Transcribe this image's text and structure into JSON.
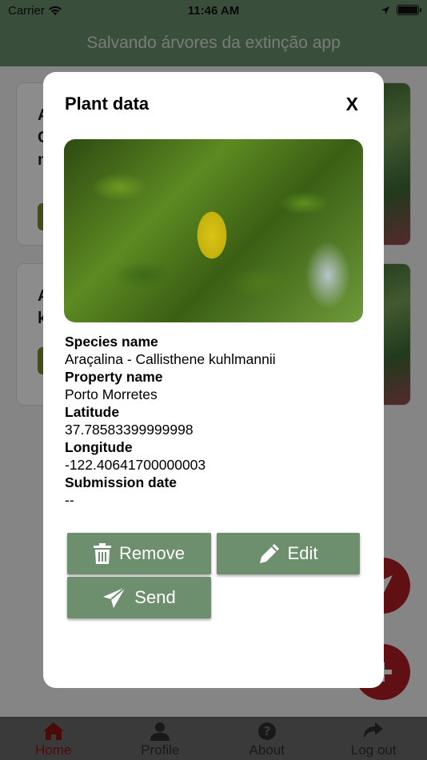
{
  "status_bar": {
    "carrier": "Carrier",
    "time": "11:46 AM"
  },
  "header": {
    "title": "Salvando árvores da extinção app"
  },
  "background_cards": [
    {
      "title_lines": [
        "A",
        "C",
        "n"
      ]
    },
    {
      "title_lines": [
        "A",
        "k"
      ]
    }
  ],
  "modal": {
    "title": "Plant data",
    "close_label": "X",
    "fields": [
      {
        "label": "Species name",
        "value": "Araçalina - Callisthene kuhlmannii"
      },
      {
        "label": "Property name",
        "value": "Porto Morretes"
      },
      {
        "label": "Latitude",
        "value": "37.78583399999998"
      },
      {
        "label": "Longitude",
        "value": "-122.40641700000003"
      },
      {
        "label": "Submission date",
        "value": "--"
      }
    ],
    "buttons": {
      "remove": "Remove",
      "edit": "Edit",
      "send": "Send"
    }
  },
  "tabs": [
    {
      "label": "Home",
      "icon": "home-icon",
      "active": true
    },
    {
      "label": "Profile",
      "icon": "user-icon",
      "active": false
    },
    {
      "label": "About",
      "icon": "question-icon",
      "active": false
    },
    {
      "label": "Log out",
      "icon": "share-arrow-icon",
      "active": false
    }
  ],
  "colors": {
    "header": "#6b8e6e",
    "button": "#6e8f6e",
    "accent": "#b01e24",
    "active_tab": "#8a1512"
  }
}
